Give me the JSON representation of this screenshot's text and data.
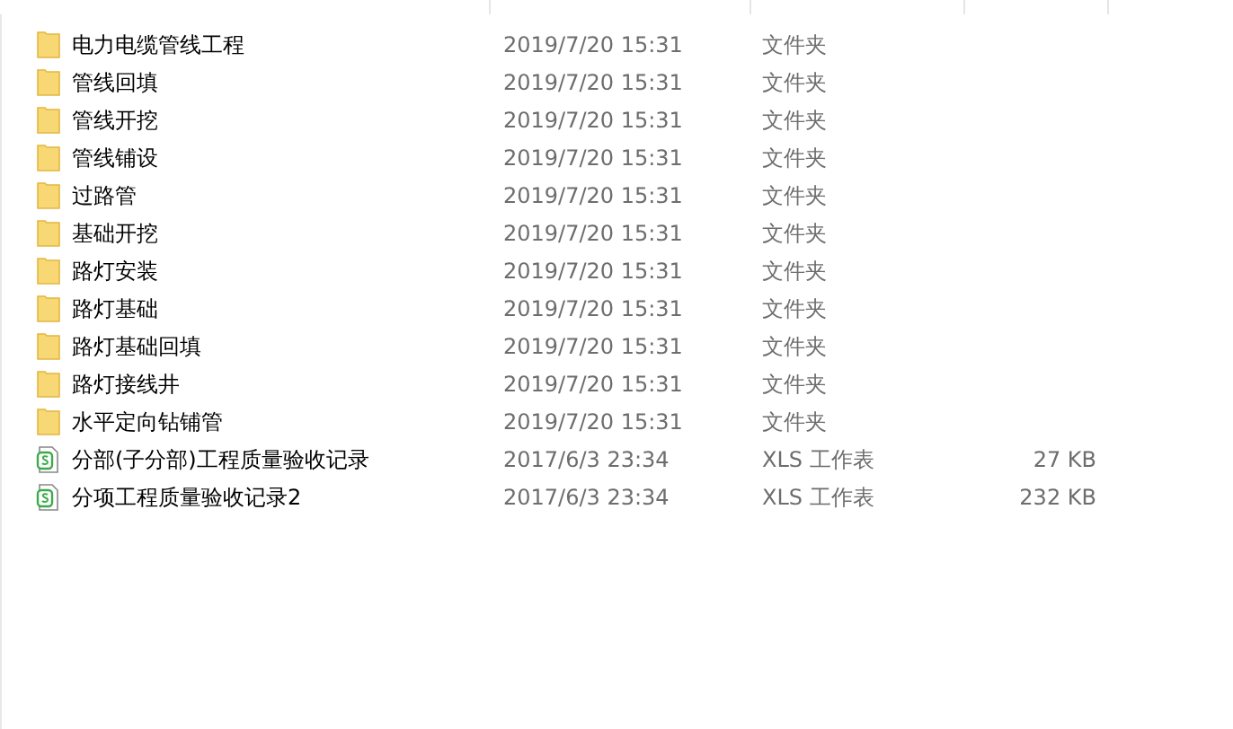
{
  "files": [
    {
      "kind": "folder",
      "name": "电力电缆管线工程",
      "date": "2019/7/20 15:31",
      "type": "文件夹"
    },
    {
      "kind": "folder",
      "name": "管线回填",
      "date": "2019/7/20 15:31",
      "type": "文件夹"
    },
    {
      "kind": "folder",
      "name": "管线开挖",
      "date": "2019/7/20 15:31",
      "type": "文件夹"
    },
    {
      "kind": "folder",
      "name": "管线铺设",
      "date": "2019/7/20 15:31",
      "type": "文件夹"
    },
    {
      "kind": "folder",
      "name": "过路管",
      "date": "2019/7/20 15:31",
      "type": "文件夹"
    },
    {
      "kind": "folder",
      "name": "基础开挖",
      "date": "2019/7/20 15:31",
      "type": "文件夹"
    },
    {
      "kind": "folder",
      "name": "路灯安装",
      "date": "2019/7/20 15:31",
      "type": "文件夹"
    },
    {
      "kind": "folder",
      "name": "路灯基础",
      "date": "2019/7/20 15:31",
      "type": "文件夹"
    },
    {
      "kind": "folder",
      "name": "路灯基础回填",
      "date": "2019/7/20 15:31",
      "type": "文件夹"
    },
    {
      "kind": "folder",
      "name": "路灯接线井",
      "date": "2019/7/20 15:31",
      "type": "文件夹"
    },
    {
      "kind": "folder",
      "name": "水平定向钻铺管",
      "date": "2019/7/20 15:31",
      "type": "文件夹"
    },
    {
      "kind": "spreadsheet",
      "name": "分部(子分部)工程质量验收记录",
      "date": "2017/6/3 23:34",
      "type": "XLS 工作表",
      "size": "27 KB"
    },
    {
      "kind": "spreadsheet",
      "name": "分项工程质量验收记录2",
      "date": "2017/6/3 23:34",
      "type": "XLS 工作表",
      "size": "232 KB"
    }
  ]
}
